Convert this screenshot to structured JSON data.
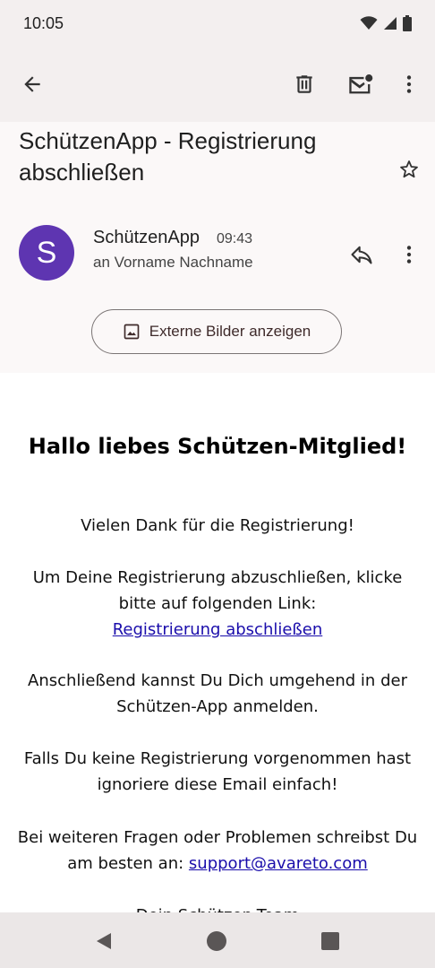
{
  "status": {
    "time": "10:05"
  },
  "email": {
    "subject": "SchützenApp - Registrierung abschließen",
    "sender": "SchützenApp",
    "time": "09:43",
    "recipient": "an Vorname Nachname",
    "avatar_letter": "S",
    "avatar_color": "#5e35b1",
    "external_images_label": "Externe Bilder anzeigen"
  },
  "body": {
    "greeting": "Hallo liebes Schützen-Mitglied!",
    "thanks": "Vielen Dank für die Registrierung!",
    "instruction": "Um Deine Registrierung abzuschließen, klicke bitte auf folgenden Link:",
    "link_label": "Registrierung abschließen",
    "afterwards": "Anschließend kannst Du Dich umgehend in der Schützen-App anmelden.",
    "ignore": "Falls Du keine Registrierung vorgenommen hast ignoriere diese Email einfach!",
    "questions": "Bei weiteren Fragen oder Problemen schreibst Du am besten an:",
    "support_email": "support@avareto.com",
    "signature": "Dein Schützen-Team"
  },
  "icons": {
    "back": "back-arrow-icon",
    "delete": "trash-icon",
    "mark_unread": "mail-unread-icon",
    "more": "more-vert-icon",
    "star": "star-icon",
    "reply": "reply-icon",
    "image": "image-icon"
  }
}
